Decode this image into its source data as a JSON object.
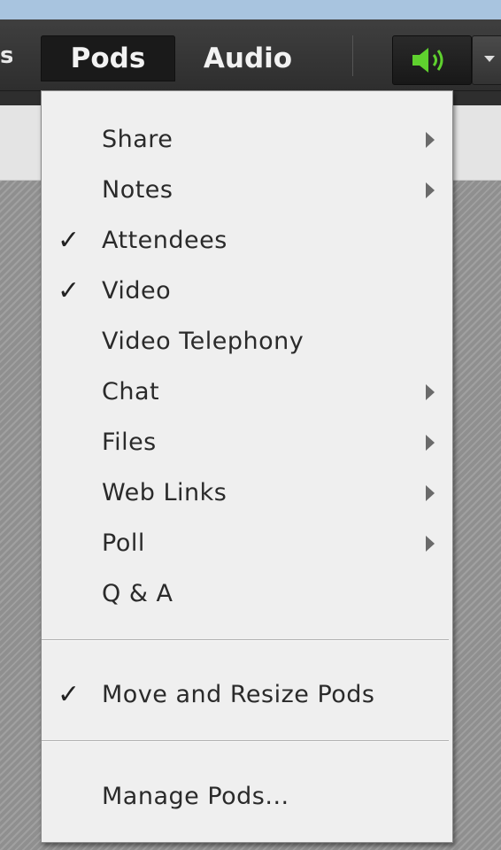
{
  "menubar": {
    "partial_left": "s",
    "items": [
      {
        "label": "Pods",
        "active": true
      },
      {
        "label": "Audio",
        "active": false
      }
    ],
    "speaker_icon": "speaker-volume-icon",
    "speaker_color": "#5fd12e"
  },
  "pods_menu": {
    "items": [
      {
        "label": "Share",
        "checked": false,
        "submenu": true
      },
      {
        "label": "Notes",
        "checked": false,
        "submenu": true
      },
      {
        "label": "Attendees",
        "checked": true,
        "submenu": false
      },
      {
        "label": "Video",
        "checked": true,
        "submenu": false
      },
      {
        "label": "Video Telephony",
        "checked": false,
        "submenu": false
      },
      {
        "label": "Chat",
        "checked": false,
        "submenu": true
      },
      {
        "label": "Files",
        "checked": false,
        "submenu": true
      },
      {
        "label": "Web Links",
        "checked": false,
        "submenu": true
      },
      {
        "label": "Poll",
        "checked": false,
        "submenu": true
      },
      {
        "label": "Q & A",
        "checked": false,
        "submenu": false
      }
    ],
    "move_resize": {
      "label": "Move and Resize Pods",
      "checked": true
    },
    "manage": {
      "label": "Manage Pods..."
    },
    "check_glyph": "✓"
  }
}
